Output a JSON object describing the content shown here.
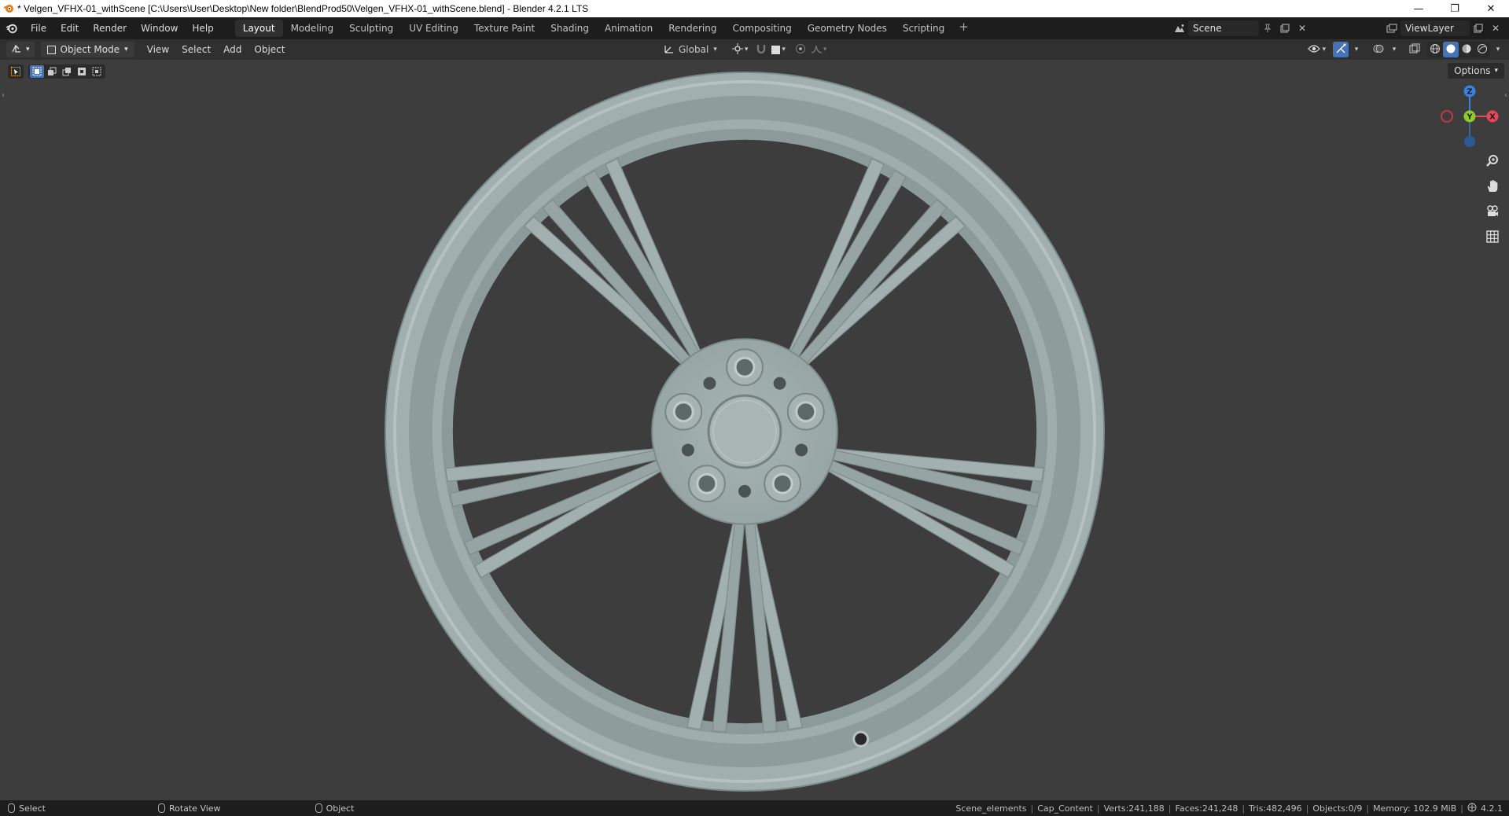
{
  "titlebar": {
    "title": "* Velgen_VFHX-01_withScene [C:\\Users\\User\\Desktop\\New folder\\BlendProd50\\Velgen_VFHX-01_withScene.blend] - Blender 4.2.1 LTS",
    "minimize": "—",
    "restore": "❐",
    "close": "✕"
  },
  "menus": [
    "File",
    "Edit",
    "Render",
    "Window",
    "Help"
  ],
  "workspaces": [
    "Layout",
    "Modeling",
    "Sculpting",
    "UV Editing",
    "Texture Paint",
    "Shading",
    "Animation",
    "Rendering",
    "Compositing",
    "Geometry Nodes",
    "Scripting"
  ],
  "active_workspace": "Layout",
  "add_workspace": "+",
  "scene": {
    "name": "Scene"
  },
  "view_layer": {
    "name": "ViewLayer"
  },
  "viewport_header": {
    "mode": "Object Mode",
    "menus": [
      "View",
      "Select",
      "Add",
      "Object"
    ],
    "transform_orientation": "Global"
  },
  "viewport": {
    "options_label": "Options",
    "gizmo": {
      "z": "Z",
      "y": "Y",
      "x": "X"
    },
    "colors": {
      "x_axis": "#e8475a",
      "y_axis": "#8fcc2a",
      "z_axis": "#3b82e0",
      "wheel": "#a6b3b3",
      "background": "#3d3d3d"
    }
  },
  "statusbar": {
    "left": [
      {
        "label": "Select"
      },
      {
        "label": "Rotate View"
      },
      {
        "label": "Object"
      }
    ],
    "stats": [
      "Scene_elements",
      "Cap_Content",
      "Verts:241,188",
      "Faces:241,248",
      "Tris:482,496",
      "Objects:0/9",
      "Memory: 102.9 MiB"
    ],
    "version": "4.2.1"
  }
}
